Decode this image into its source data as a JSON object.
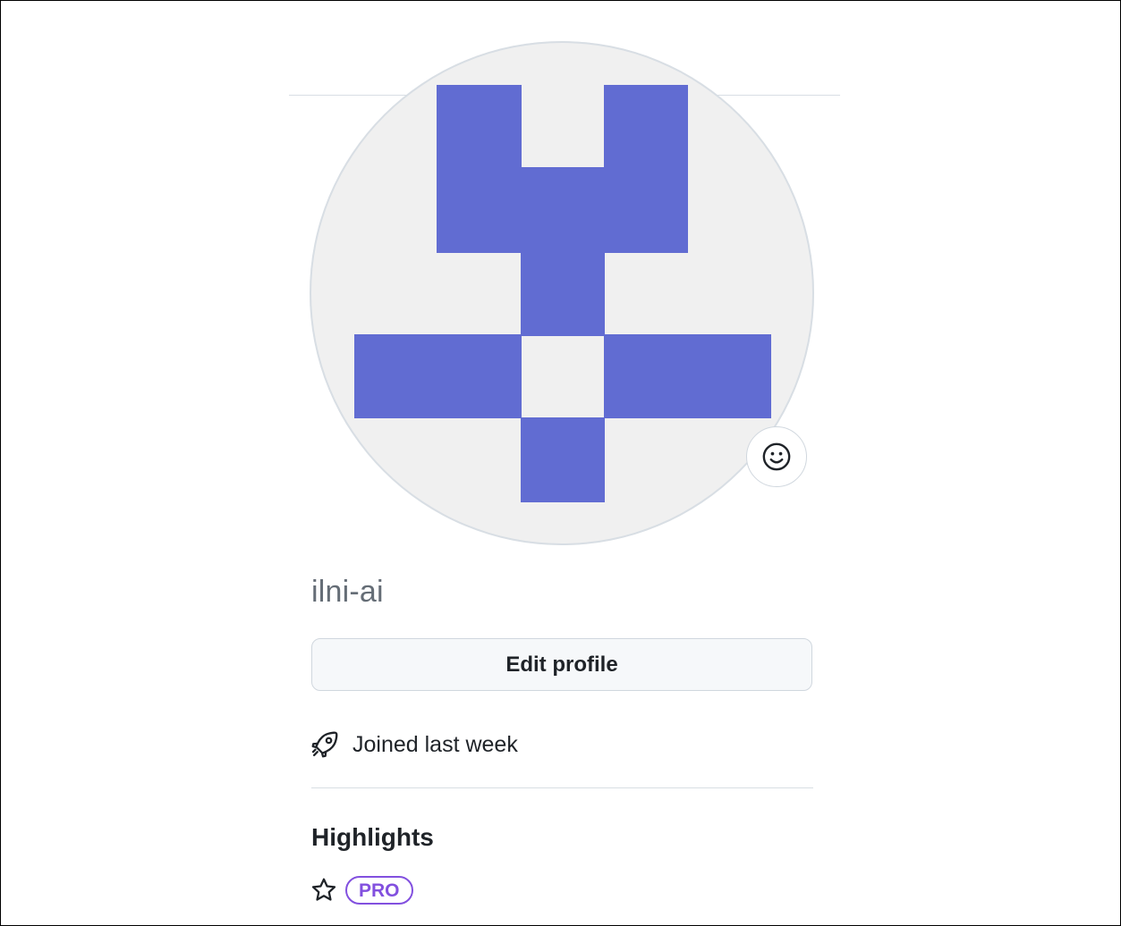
{
  "profile": {
    "username": "ilni-ai",
    "edit_button_label": "Edit profile",
    "joined_text": "Joined last week"
  },
  "avatar": {
    "background_color": "#f0f0f0",
    "pattern_color": "#616cd2"
  },
  "highlights": {
    "title": "Highlights",
    "badge_label": "PRO",
    "badge_color": "#8250df"
  },
  "icons": {
    "emoji_status": "smiley-icon",
    "joined": "rocket-icon",
    "highlight": "star-icon"
  }
}
